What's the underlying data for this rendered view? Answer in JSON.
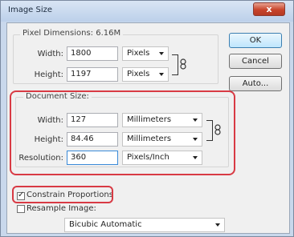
{
  "window": {
    "title": "Image Size",
    "close_glyph": "x"
  },
  "pixel_dimensions": {
    "legend": "Pixel Dimensions:  6.16M",
    "width_label": "Width:",
    "width_value": "1800",
    "width_unit": "Pixels",
    "height_label": "Height:",
    "height_value": "1197",
    "height_unit": "Pixels"
  },
  "document_size": {
    "legend": "Document Size:",
    "width_label": "Width:",
    "width_value": "127",
    "width_unit": "Millimeters",
    "height_label": "Height:",
    "height_value": "84.46",
    "height_unit": "Millimeters",
    "resolution_label": "Resolution:",
    "resolution_value": "360",
    "resolution_unit": "Pixels/Inch"
  },
  "options": {
    "constrain_label": "Constrain Proportions",
    "constrain_checked": true,
    "resample_label": "Resample Image:",
    "resample_method": "Bicubic Automatic"
  },
  "buttons": {
    "ok": "OK",
    "cancel": "Cancel",
    "auto": "Auto..."
  },
  "colors": {
    "highlight": "#d83a44",
    "title_bar": "#c9d8ec",
    "dialog_bg": "#f0f0f0"
  }
}
